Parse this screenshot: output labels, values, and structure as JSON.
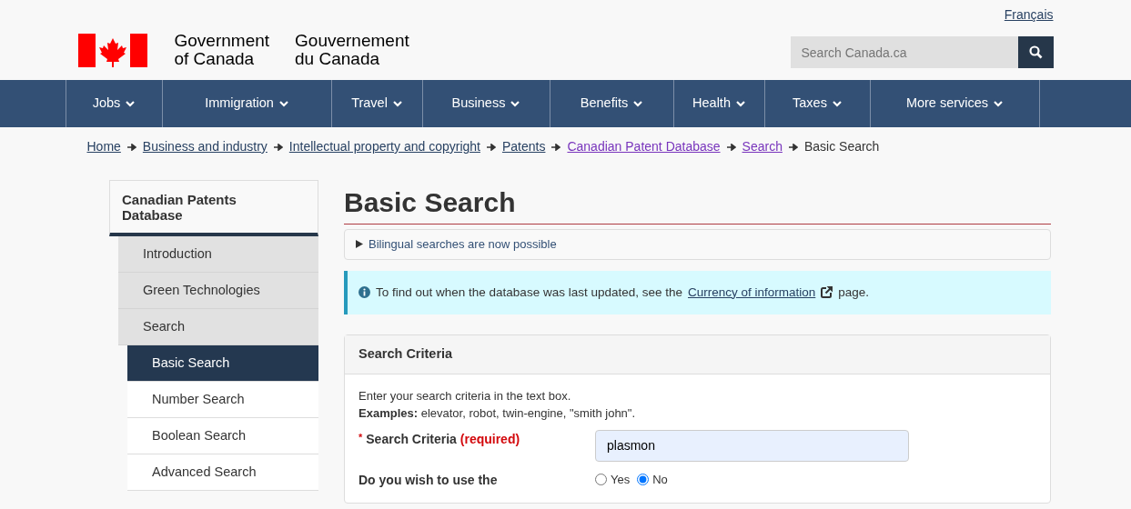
{
  "language_link": "Français",
  "brand": {
    "english": [
      "Government",
      "of Canada"
    ],
    "french": [
      "Gouvernement",
      "du Canada"
    ]
  },
  "site_search": {
    "placeholder": "Search Canada.ca"
  },
  "menu": [
    {
      "label": "Jobs"
    },
    {
      "label": "Immigration"
    },
    {
      "label": "Travel"
    },
    {
      "label": "Business"
    },
    {
      "label": "Benefits"
    },
    {
      "label": "Health"
    },
    {
      "label": "Taxes"
    },
    {
      "label": "More services"
    }
  ],
  "breadcrumb": [
    {
      "label": "Home",
      "kind": "link",
      "visited": false
    },
    {
      "label": "Business and industry",
      "kind": "link",
      "visited": false
    },
    {
      "label": "Intellectual property and copyright",
      "kind": "link",
      "visited": false
    },
    {
      "label": "Patents",
      "kind": "link",
      "visited": false
    },
    {
      "label": "Canadian Patent Database",
      "kind": "link",
      "visited": true
    },
    {
      "label": "Search",
      "kind": "link",
      "visited": true
    },
    {
      "label": "Basic Search",
      "kind": "current"
    }
  ],
  "sidebar": {
    "title": "Canadian Patents Database",
    "items": [
      {
        "label": "Introduction",
        "selected": false
      },
      {
        "label": "Green Technologies",
        "selected": false
      },
      {
        "label": "Search",
        "selected": false,
        "children": [
          {
            "label": "Basic Search",
            "selected": true
          },
          {
            "label": "Number Search",
            "selected": false
          },
          {
            "label": "Boolean Search",
            "selected": false
          },
          {
            "label": "Advanced Search",
            "selected": false
          }
        ]
      }
    ]
  },
  "page_title": "Basic Search",
  "details": {
    "summary": "Bilingual searches are now possible",
    "expanded": false
  },
  "info": {
    "before": "To find out when the database was last updated, see the",
    "link": "Currency of information",
    "after": "page."
  },
  "criteria_panel": {
    "title": "Search Criteria",
    "instructions": [
      "Enter your search criteria in the text box.",
      "**Examples:** elevator, robot, twin-engine, \"smith john\"."
    ],
    "fields": [
      {
        "kind": "text",
        "required_mark": "*",
        "label": "Search Criteria",
        "required_note": "(required)",
        "value": "plasmon"
      },
      {
        "kind": "radio",
        "label": "Do you wish to use the",
        "options": [
          {
            "label": "Yes",
            "selected": false
          },
          {
            "label": "No",
            "selected": true
          }
        ]
      }
    ]
  }
}
